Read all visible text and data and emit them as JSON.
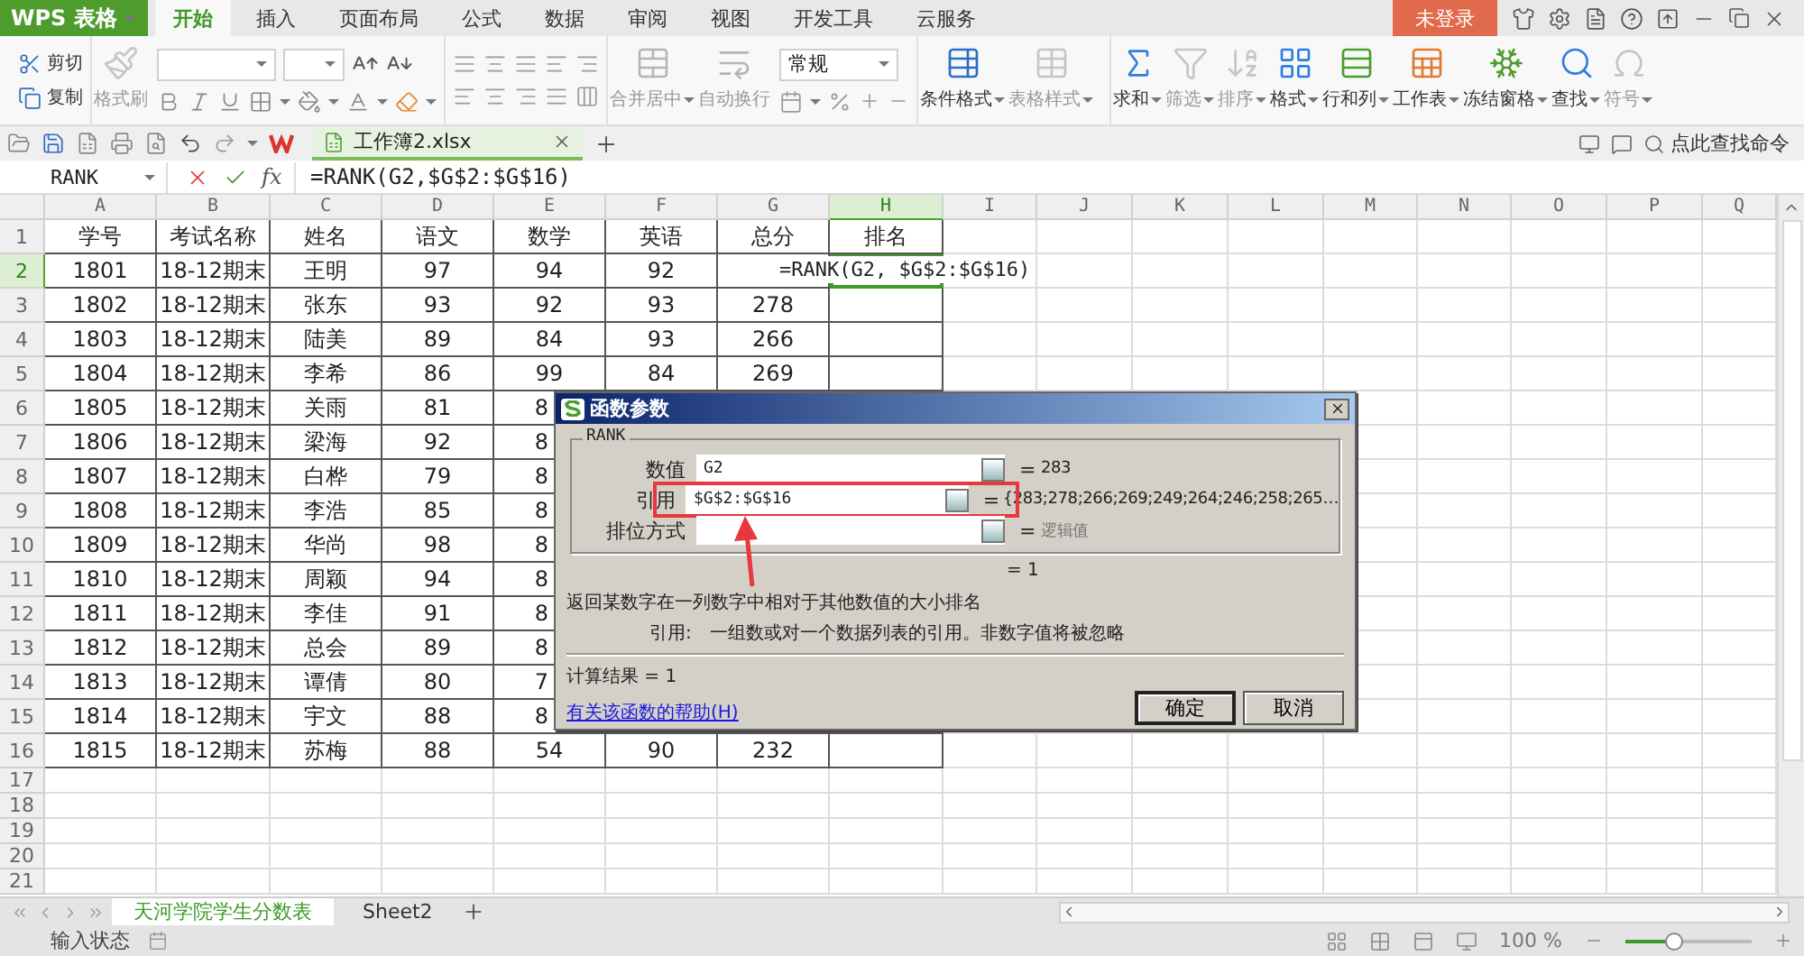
{
  "app_menu": {
    "label": "WPS 表格"
  },
  "menu_tabs": [
    {
      "label": "开始",
      "selected": true
    },
    {
      "label": "插入",
      "selected": false
    },
    {
      "label": "页面布局",
      "selected": false
    },
    {
      "label": "公式",
      "selected": false
    },
    {
      "label": "数据",
      "selected": false
    },
    {
      "label": "审阅",
      "selected": false
    },
    {
      "label": "视图",
      "selected": false
    },
    {
      "label": "开发工具",
      "selected": false
    },
    {
      "label": "云服务",
      "selected": false
    }
  ],
  "login": {
    "label": "未登录"
  },
  "ribbon": {
    "cut": {
      "label": "剪切",
      "disabled": false
    },
    "copy": {
      "label": "复制",
      "disabled": false
    },
    "format_painter": {
      "label": "格式刷",
      "disabled": true
    },
    "merge_buttons": [
      {
        "label": "合并居中",
        "disabled": true,
        "dropdown": true
      },
      {
        "label": "自动换行",
        "disabled": true,
        "dropdown": false
      }
    ],
    "number_format": "常规",
    "style_buttons": [
      {
        "label": "条件格式",
        "disabled": false,
        "dropdown": true
      },
      {
        "label": "表格样式",
        "disabled": true,
        "dropdown": true
      }
    ],
    "edit_buttons": [
      {
        "label": "求和",
        "disabled": false,
        "dropdown": true
      },
      {
        "label": "筛选",
        "disabled": true,
        "dropdown": true
      },
      {
        "label": "排序",
        "disabled": true,
        "dropdown": true
      },
      {
        "label": "格式",
        "disabled": false,
        "dropdown": true
      },
      {
        "label": "行和列",
        "disabled": false,
        "dropdown": true
      },
      {
        "label": "工作表",
        "disabled": false,
        "dropdown": true
      },
      {
        "label": "冻结窗格",
        "disabled": false,
        "dropdown": true
      },
      {
        "label": "查找",
        "disabled": false,
        "dropdown": true
      },
      {
        "label": "符号",
        "disabled": true,
        "dropdown": true
      }
    ]
  },
  "document_tab": {
    "title": "工作簿2.xlsx"
  },
  "command_search": {
    "placeholder": "点此查找命令"
  },
  "formula_bar": {
    "name_box": "RANK",
    "fx": "fx",
    "formula": "=RANK(G2,$G$2:$G$16)"
  },
  "sheet": {
    "columns": [
      {
        "label": "A",
        "selected": false
      },
      {
        "label": "B",
        "selected": false
      },
      {
        "label": "C",
        "selected": false
      },
      {
        "label": "D",
        "selected": false
      },
      {
        "label": "E",
        "selected": false
      },
      {
        "label": "F",
        "selected": false
      },
      {
        "label": "G",
        "selected": false
      },
      {
        "label": "H",
        "selected": true
      },
      {
        "label": "I",
        "selected": false
      },
      {
        "label": "J",
        "selected": false
      },
      {
        "label": "K",
        "selected": false
      },
      {
        "label": "L",
        "selected": false
      },
      {
        "label": "M",
        "selected": false
      },
      {
        "label": "N",
        "selected": false
      },
      {
        "label": "O",
        "selected": false
      },
      {
        "label": "P",
        "selected": false
      },
      {
        "label": "Q",
        "selected": false
      }
    ],
    "editing_text": "=RANK(G2, $G$2:$G$16)",
    "rows": [
      {
        "label": "1",
        "selected": false,
        "cells": [
          "学号",
          "考试名称",
          "姓名",
          "语文",
          "数学",
          "英语",
          "总分",
          "排名"
        ]
      },
      {
        "label": "2",
        "selected": true,
        "cells": [
          "1801",
          "18-12期末",
          "王明",
          "97",
          "94",
          "92"
        ]
      },
      {
        "label": "3",
        "selected": false,
        "cells": [
          "1802",
          "18-12期末",
          "张东",
          "93",
          "92",
          "93",
          "278"
        ]
      },
      {
        "label": "4",
        "selected": false,
        "cells": [
          "1803",
          "18-12期末",
          "陆美",
          "89",
          "84",
          "93",
          "266"
        ]
      },
      {
        "label": "5",
        "selected": false,
        "cells": [
          "1804",
          "18-12期末",
          "李希",
          "86",
          "99",
          "84",
          "269"
        ]
      },
      {
        "label": "6",
        "selected": false,
        "cells": [
          "1805",
          "18-12期末",
          "关雨",
          "81",
          {
            "text": "8",
            "cut": true
          }
        ]
      },
      {
        "label": "7",
        "selected": false,
        "cells": [
          "1806",
          "18-12期末",
          "梁海",
          "92",
          {
            "text": "8",
            "cut": true
          }
        ]
      },
      {
        "label": "8",
        "selected": false,
        "cells": [
          "1807",
          "18-12期末",
          "白桦",
          "79",
          {
            "text": "8",
            "cut": true
          }
        ]
      },
      {
        "label": "9",
        "selected": false,
        "cells": [
          "1808",
          "18-12期末",
          "李浩",
          "85",
          {
            "text": "8",
            "cut": true
          }
        ]
      },
      {
        "label": "10",
        "selected": false,
        "cells": [
          "1809",
          "18-12期末",
          "华尚",
          "98",
          {
            "text": "8",
            "cut": true
          }
        ]
      },
      {
        "label": "11",
        "selected": false,
        "cells": [
          "1810",
          "18-12期末",
          "周颖",
          "94",
          {
            "text": "8",
            "cut": true
          }
        ]
      },
      {
        "label": "12",
        "selected": false,
        "cells": [
          "1811",
          "18-12期末",
          "李佳",
          "91",
          {
            "text": "8",
            "cut": true
          }
        ]
      },
      {
        "label": "13",
        "selected": false,
        "cells": [
          "1812",
          "18-12期末",
          "总会",
          "89",
          {
            "text": "8",
            "cut": true
          }
        ]
      },
      {
        "label": "14",
        "selected": false,
        "cells": [
          "1813",
          "18-12期末",
          "谭倩",
          "80",
          {
            "text": "7",
            "cut": true
          }
        ]
      },
      {
        "label": "15",
        "selected": false,
        "cells": [
          "1814",
          "18-12期末",
          "宇文",
          "88",
          {
            "text": "8",
            "cut": true
          }
        ]
      },
      {
        "label": "16",
        "selected": false,
        "cells": [
          "1815",
          "18-12期末",
          "苏梅",
          "88",
          "54",
          "90",
          "232"
        ]
      },
      {
        "label": "17",
        "selected": false
      },
      {
        "label": "18",
        "selected": false
      },
      {
        "label": "19",
        "selected": false
      },
      {
        "label": "20",
        "selected": false
      },
      {
        "label": "21",
        "selected": false
      }
    ]
  },
  "dialog": {
    "title": "函数参数",
    "function": "RANK",
    "fields": [
      {
        "label": "数值",
        "value": "G2",
        "eq": "=",
        "result": "283",
        "hint": false,
        "highlighted": false
      },
      {
        "label": "引用",
        "value": "$G$2:$G$16",
        "eq": "=",
        "result": "{283;278;266;269;249;264;246;258;265…",
        "hint": false,
        "highlighted": true
      },
      {
        "label": "排位方式",
        "eq": "=",
        "result": "逻辑值",
        "hint": true,
        "highlighted": false
      }
    ],
    "formula_result": "= 1",
    "description": "返回某数字在一列数字中相对于其他数值的大小排名",
    "argument_label": "引用:",
    "argument_help": "一组数或对一个数据列表的引用。非数字值将被忽略",
    "calc_result": "计算结果 = 1",
    "help_link": "有关该函数的帮助(H)",
    "buttons": [
      "确定",
      "取消"
    ]
  },
  "sheet_tabs": [
    {
      "label": "天河学院学生分数表",
      "selected": true
    },
    {
      "label": "Sheet2",
      "selected": false
    }
  ],
  "status_bar": {
    "mode": "输入状态",
    "zoom": "100 %",
    "zoom_slider": {
      "level": 0.38
    }
  }
}
